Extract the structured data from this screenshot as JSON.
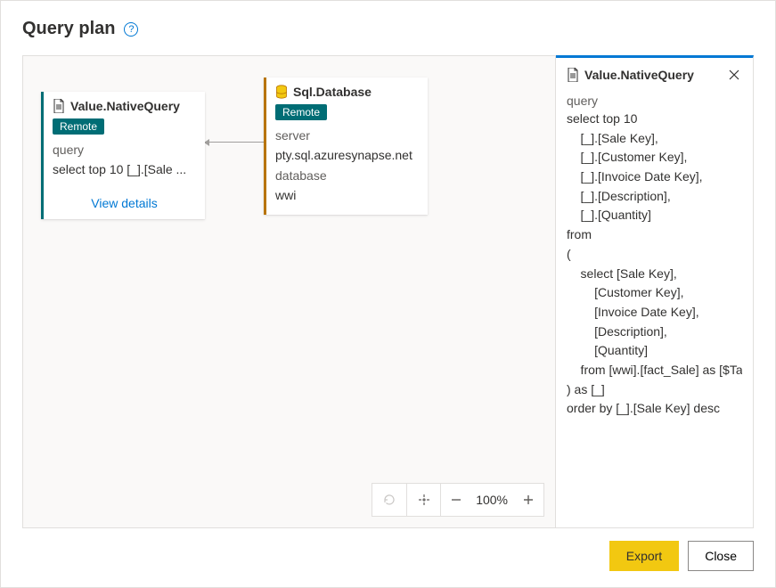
{
  "header": {
    "title": "Query plan"
  },
  "canvas": {
    "nodes": {
      "nativeQuery": {
        "title": "Value.NativeQuery",
        "badge": "Remote",
        "paramLabel": "query",
        "paramValue": "select top 10 [_].[Sale ...",
        "viewDetails": "View details"
      },
      "sqlDatabase": {
        "title": "Sql.Database",
        "badge": "Remote",
        "serverLabel": "server",
        "serverValue": "pty.sql.azuresynapse.net",
        "databaseLabel": "database",
        "databaseValue": "wwi"
      }
    },
    "zoom": {
      "percent": "100%"
    }
  },
  "details": {
    "title": "Value.NativeQuery",
    "paramLabel": "query",
    "queryText": "select top 10\n    [_].[Sale Key],\n    [_].[Customer Key],\n    [_].[Invoice Date Key],\n    [_].[Description],\n    [_].[Quantity]\nfrom\n(\n    select [Sale Key],\n        [Customer Key],\n        [Invoice Date Key],\n        [Description],\n        [Quantity]\n    from [wwi].[fact_Sale] as [$Table]\n) as [_]\norder by [_].[Sale Key] desc"
  },
  "footer": {
    "export": "Export",
    "close": "Close"
  }
}
